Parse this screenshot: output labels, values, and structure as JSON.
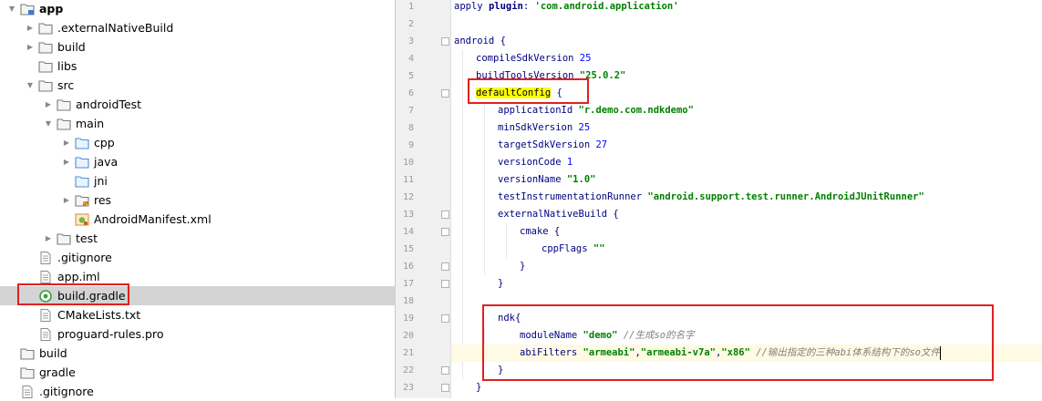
{
  "tree": {
    "items": [
      {
        "label": "app",
        "depth": 0,
        "arrow": "open",
        "icon": "folder-module-icon",
        "bold": true
      },
      {
        "label": ".externalNativeBuild",
        "depth": 1,
        "arrow": "closed",
        "icon": "folder-icon"
      },
      {
        "label": "build",
        "depth": 1,
        "arrow": "closed",
        "icon": "folder-icon"
      },
      {
        "label": "libs",
        "depth": 1,
        "arrow": "none",
        "icon": "folder-icon"
      },
      {
        "label": "src",
        "depth": 1,
        "arrow": "open",
        "icon": "folder-icon"
      },
      {
        "label": "androidTest",
        "depth": 2,
        "arrow": "closed",
        "icon": "folder-icon"
      },
      {
        "label": "main",
        "depth": 2,
        "arrow": "open",
        "icon": "folder-icon"
      },
      {
        "label": "cpp",
        "depth": 3,
        "arrow": "closed",
        "icon": "folder-source-icon"
      },
      {
        "label": "java",
        "depth": 3,
        "arrow": "closed",
        "icon": "folder-source-icon"
      },
      {
        "label": "jni",
        "depth": 3,
        "arrow": "none",
        "icon": "folder-source-icon"
      },
      {
        "label": "res",
        "depth": 3,
        "arrow": "closed",
        "icon": "folder-resource-icon"
      },
      {
        "label": "AndroidManifest.xml",
        "depth": 3,
        "arrow": "none",
        "icon": "manifest-icon"
      },
      {
        "label": "test",
        "depth": 2,
        "arrow": "closed",
        "icon": "folder-icon"
      },
      {
        "label": ".gitignore",
        "depth": 1,
        "arrow": "none",
        "icon": "file-icon"
      },
      {
        "label": "app.iml",
        "depth": 1,
        "arrow": "none",
        "icon": "file-icon"
      },
      {
        "label": "build.gradle",
        "depth": 1,
        "arrow": "none",
        "icon": "gradle-icon",
        "selected": true
      },
      {
        "label": "CMakeLists.txt",
        "depth": 1,
        "arrow": "none",
        "icon": "file-icon"
      },
      {
        "label": "proguard-rules.pro",
        "depth": 1,
        "arrow": "none",
        "icon": "file-icon"
      },
      {
        "label": "build",
        "depth": 0,
        "arrow": "none",
        "icon": "folder-icon"
      },
      {
        "label": "gradle",
        "depth": 0,
        "arrow": "none",
        "icon": "folder-icon"
      },
      {
        "label": ".gitignore",
        "depth": 0,
        "arrow": "none",
        "icon": "file-icon"
      }
    ]
  },
  "editor": {
    "line_numbers": [
      "1",
      "2",
      "3",
      "4",
      "5",
      "6",
      "7",
      "8",
      "9",
      "10",
      "11",
      "12",
      "13",
      "14",
      "15",
      "16",
      "17",
      "18",
      "19",
      "20",
      "21",
      "22",
      "23"
    ],
    "lines": [
      {
        "n": 1,
        "indent": 0,
        "tokens": [
          [
            "t",
            "apply "
          ],
          [
            "kw",
            "plugin"
          ],
          [
            "t",
            ": "
          ],
          [
            "str",
            "'com.android.application'"
          ]
        ]
      },
      {
        "n": 2,
        "indent": 0,
        "tokens": []
      },
      {
        "n": 3,
        "indent": 0,
        "tokens": [
          [
            "t",
            "android {"
          ]
        ]
      },
      {
        "n": 4,
        "indent": 1,
        "tokens": [
          [
            "t",
            "compileSdkVersion "
          ],
          [
            "num",
            "25"
          ]
        ]
      },
      {
        "n": 5,
        "indent": 1,
        "tokens": [
          [
            "t",
            "buildToolsVersion "
          ],
          [
            "str",
            "\"25.0.2\""
          ]
        ]
      },
      {
        "n": 6,
        "indent": 1,
        "tokens": [
          [
            "hl",
            "defaultConfig"
          ],
          [
            "t",
            " {"
          ]
        ]
      },
      {
        "n": 7,
        "indent": 2,
        "tokens": [
          [
            "t",
            "applicationId "
          ],
          [
            "str",
            "\"r.demo.com.ndkdemo\""
          ]
        ]
      },
      {
        "n": 8,
        "indent": 2,
        "tokens": [
          [
            "t",
            "minSdkVersion "
          ],
          [
            "num",
            "25"
          ]
        ]
      },
      {
        "n": 9,
        "indent": 2,
        "tokens": [
          [
            "t",
            "targetSdkVersion "
          ],
          [
            "num",
            "27"
          ]
        ]
      },
      {
        "n": 10,
        "indent": 2,
        "tokens": [
          [
            "t",
            "versionCode "
          ],
          [
            "num",
            "1"
          ]
        ]
      },
      {
        "n": 11,
        "indent": 2,
        "tokens": [
          [
            "t",
            "versionName "
          ],
          [
            "str",
            "\"1.0\""
          ]
        ]
      },
      {
        "n": 12,
        "indent": 2,
        "tokens": [
          [
            "t",
            "testInstrumentationRunner "
          ],
          [
            "str",
            "\"android.support.test.runner.AndroidJUnitRunner\""
          ]
        ]
      },
      {
        "n": 13,
        "indent": 2,
        "tokens": [
          [
            "t",
            "externalNativeBuild {"
          ]
        ]
      },
      {
        "n": 14,
        "indent": 3,
        "tokens": [
          [
            "t",
            "cmake {"
          ]
        ]
      },
      {
        "n": 15,
        "indent": 4,
        "tokens": [
          [
            "t",
            "cppFlags "
          ],
          [
            "str",
            "\"\""
          ]
        ]
      },
      {
        "n": 16,
        "indent": 3,
        "tokens": [
          [
            "t",
            "}"
          ]
        ]
      },
      {
        "n": 17,
        "indent": 2,
        "tokens": [
          [
            "t",
            "}"
          ]
        ]
      },
      {
        "n": 18,
        "indent": 0,
        "tokens": []
      },
      {
        "n": 19,
        "indent": 2,
        "tokens": [
          [
            "t",
            "ndk{"
          ]
        ]
      },
      {
        "n": 20,
        "indent": 3,
        "tokens": [
          [
            "t",
            "moduleName "
          ],
          [
            "str",
            "\"demo\""
          ],
          [
            "t",
            " "
          ],
          [
            "com",
            "//生成so的名字"
          ]
        ]
      },
      {
        "n": 21,
        "indent": 3,
        "tokens": [
          [
            "t",
            "abiFilters "
          ],
          [
            "str",
            "\"armeabi\""
          ],
          [
            "t",
            ","
          ],
          [
            "str",
            "\"armeabi-v7a\""
          ],
          [
            "t",
            ","
          ],
          [
            "str",
            "\"x86\""
          ],
          [
            "t",
            " "
          ],
          [
            "com",
            "//输出指定的三种abi体系结构下的so文件"
          ]
        ],
        "current": true
      },
      {
        "n": 22,
        "indent": 2,
        "tokens": [
          [
            "t",
            "}"
          ]
        ]
      },
      {
        "n": 23,
        "indent": 1,
        "tokens": [
          [
            "t",
            "}"
          ]
        ]
      }
    ]
  },
  "colors": {
    "highlight_box": "#e02020",
    "selection": "#d4d4d4",
    "keyword": "#000080",
    "string": "#008000",
    "number": "#0000ff",
    "comment": "#808080"
  }
}
